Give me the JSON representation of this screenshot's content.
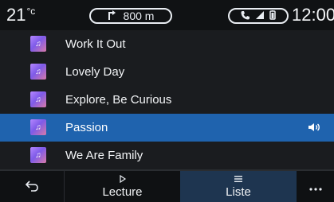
{
  "status": {
    "temperature_value": "21",
    "temperature_unit": "°c",
    "nav_distance": "800 m",
    "time": "12:00"
  },
  "icons": {
    "nav_turn": "turn-arrow-icon",
    "phone": "phone-icon",
    "signal": "signal-icon",
    "battery": "battery-icon",
    "track_art": "music-note-icon",
    "now_playing": "speaker-icon",
    "back": "back-arrow-icon",
    "lecture": "play-icon",
    "liste": "list-icon",
    "more": "more-icon"
  },
  "playlist": [
    {
      "title": "Work It Out"
    },
    {
      "title": "Lovely Day"
    },
    {
      "title": "Explore, Be Curious"
    },
    {
      "title": "Passion",
      "playing": true
    },
    {
      "title": "We Are Family"
    }
  ],
  "bottom_bar": {
    "lecture_label": "Lecture",
    "liste_label": "Liste"
  },
  "colors": {
    "active_row": "#1f63ae",
    "active_tab": "#1e3550",
    "background": "#121416"
  }
}
